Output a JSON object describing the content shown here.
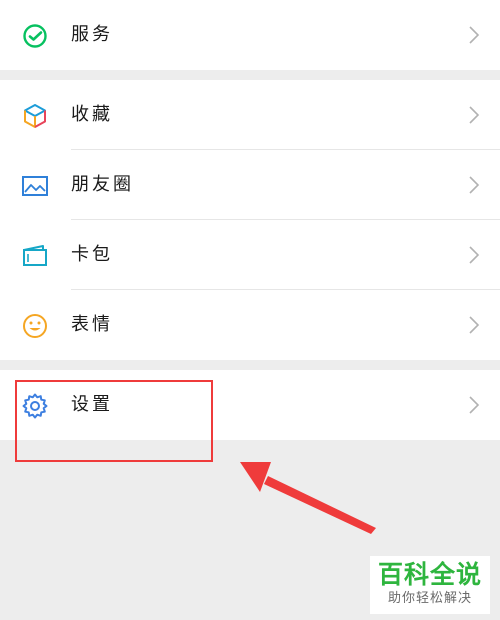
{
  "menu_groups": [
    {
      "items": [
        {
          "label": "服务",
          "icon": "service-icon"
        }
      ]
    },
    {
      "items": [
        {
          "label": "收藏",
          "icon": "favorites-cube-icon"
        },
        {
          "label": "朋友圈",
          "icon": "moments-image-icon"
        },
        {
          "label": "卡包",
          "icon": "card-wallet-icon"
        },
        {
          "label": "表情",
          "icon": "smiley-face-icon"
        }
      ]
    },
    {
      "items": [
        {
          "label": "设置",
          "icon": "gear-icon"
        }
      ]
    }
  ],
  "annotation": {
    "color": "#ef3b3b",
    "highlight_target": "设置"
  },
  "watermark": {
    "title": "百科全说",
    "subtitle": "助你轻松解决",
    "color": "#2eb53e"
  },
  "colors": {
    "background": "#ededed",
    "row_background": "#ffffff",
    "chevron": "#b2b2b2",
    "service_green": "#07c160",
    "settings_blue": "#3d7fe0"
  }
}
